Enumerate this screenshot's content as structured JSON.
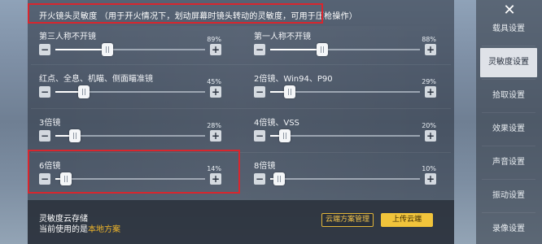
{
  "header": {
    "title": "开火镜头灵敏度 （用于开火情况下，划动屏幕时镜头转动的灵敏度，可用于压枪操作）"
  },
  "settings": [
    {
      "label": "第三人称不开镜",
      "value": "89%",
      "level": 0.35
    },
    {
      "label": "第一人称不开镜",
      "value": "88%",
      "level": 0.35
    },
    {
      "label": "红点、全息、机瞄、侧面瞄准镜",
      "value": "45%",
      "level": 0.19
    },
    {
      "label": "2倍镜、Win94、P90",
      "value": "29%",
      "level": 0.13
    },
    {
      "label": "3倍镜",
      "value": "28%",
      "level": 0.13
    },
    {
      "label": "4倍镜、VSS",
      "value": "20%",
      "level": 0.1
    },
    {
      "label": "6倍镜",
      "value": "14%",
      "level": 0.07
    },
    {
      "label": "8倍镜",
      "value": "10%",
      "level": 0.06
    }
  ],
  "controls": {
    "minus": "−",
    "plus": "+"
  },
  "cloud": {
    "title": "灵敏度云存储",
    "current_prefix": "当前使用的是",
    "current_value": "本地方案",
    "manage_button": "云端方案管理",
    "upload_button": "上传云端"
  },
  "sidebar": {
    "close": "✕",
    "items": [
      {
        "label": "载具设置"
      },
      {
        "label": "灵敏度设置"
      },
      {
        "label": "拾取设置"
      },
      {
        "label": "效果设置"
      },
      {
        "label": "声音设置"
      },
      {
        "label": "振动设置"
      },
      {
        "label": "录像设置"
      }
    ],
    "active_index": 1
  },
  "colors": {
    "highlight_red": "#d8262e",
    "accent_gold": "#f1c43b"
  }
}
